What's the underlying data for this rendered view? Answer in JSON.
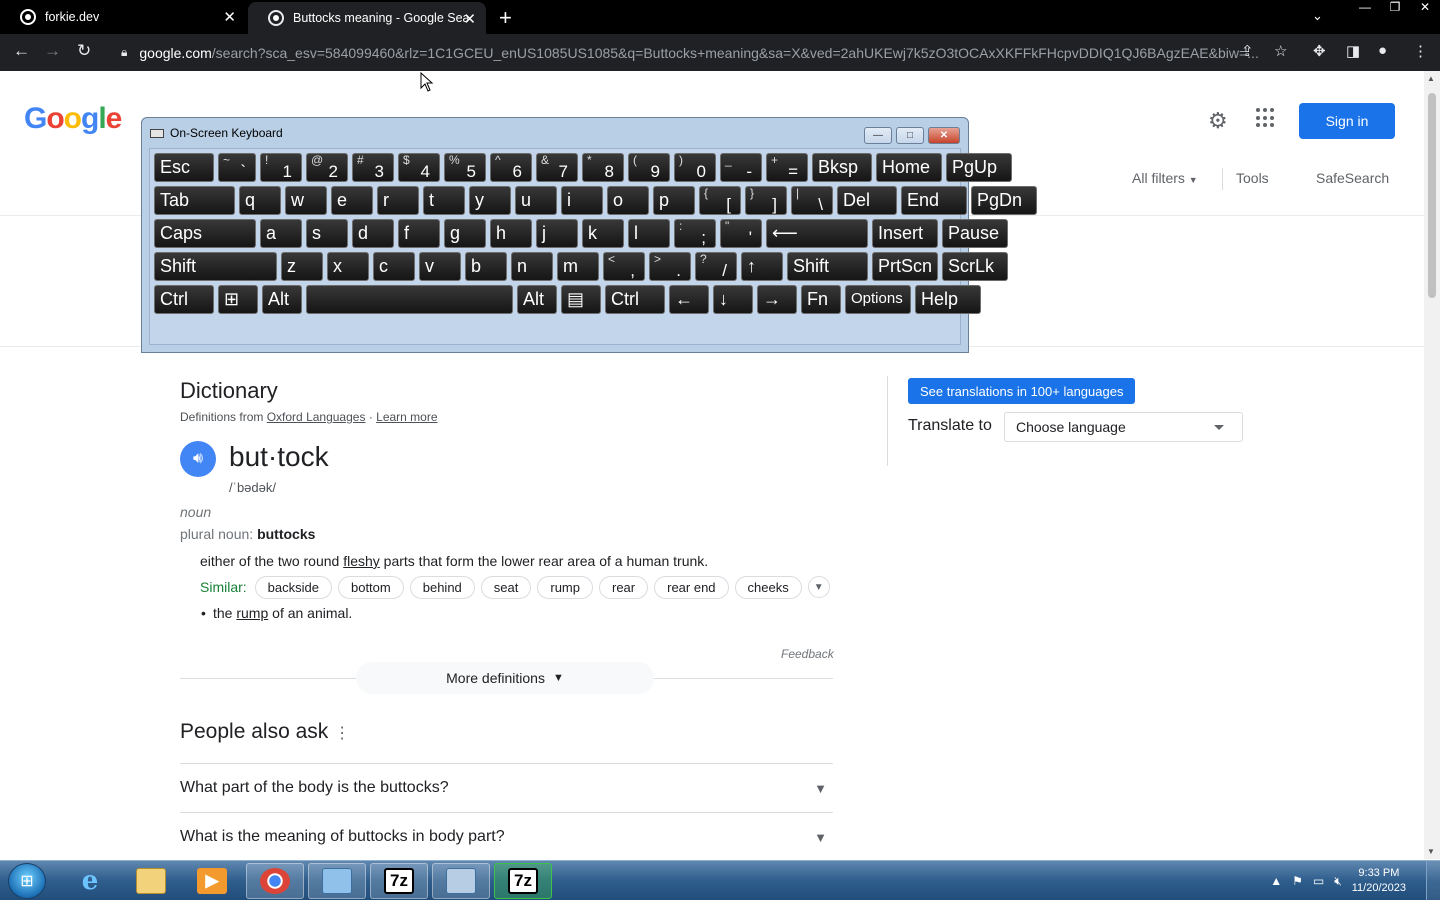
{
  "browser": {
    "tabs": [
      {
        "title": "forkie.dev"
      },
      {
        "title": "Buttocks meaning - Google Search"
      }
    ],
    "url_host": "google.com",
    "url_rest": "/search?sca_esv=584099460&rlz=1C1GCEU_enUS1085US1085&q=Buttocks+meaning&sa=X&ved=2ahUKEwj7k5zO3tOCAxXKFFkFHcpvDDIQ1QJ6BAgzEAE&biw=..."
  },
  "google": {
    "logo": [
      "G",
      "o",
      "o",
      "g",
      "l",
      "e"
    ],
    "sign_in": "Sign in",
    "filters": {
      "all_filters": "All filters",
      "tools": "Tools",
      "safesearch": "SafeSearch"
    }
  },
  "dictionary": {
    "title": "Dictionary",
    "source_prefix": "Definitions from",
    "source_link": "Oxford Languages",
    "separator": "·",
    "learn_more": "Learn more",
    "word": "but·tock",
    "phonetic": "/ˈbədək/",
    "part_of_speech": "noun",
    "plural_label": "plural noun:",
    "plural_value": "buttocks",
    "definition_1_a": "either of the two round",
    "definition_1_link": "fleshy",
    "definition_1_b": "parts that form the lower rear area of a human trunk.",
    "similar_label": "Similar:",
    "similar": [
      "backside",
      "bottom",
      "behind",
      "seat",
      "rump",
      "rear",
      "rear end",
      "cheeks"
    ],
    "definition_2_a": "the",
    "definition_2_link": "rump",
    "definition_2_b": "of an animal.",
    "feedback": "Feedback",
    "more_definitions": "More definitions"
  },
  "translate": {
    "button": "See translations in 100+ languages",
    "label": "Translate to",
    "select": "Choose language"
  },
  "people_also_ask": {
    "title": "People also ask",
    "questions": [
      "What part of the body is the buttocks?",
      "What is the meaning of buttocks in body part?"
    ]
  },
  "osk": {
    "title": "On-Screen Keyboard",
    "rows": [
      [
        {
          "m": "Esc"
        },
        {
          "s": "~",
          "m": "`"
        },
        {
          "s": "!",
          "m": "1"
        },
        {
          "s": "@",
          "m": "2"
        },
        {
          "s": "#",
          "m": "3"
        },
        {
          "s": "$",
          "m": "4"
        },
        {
          "s": "%",
          "m": "5"
        },
        {
          "s": "^",
          "m": "6"
        },
        {
          "s": "&",
          "m": "7"
        },
        {
          "s": "*",
          "m": "8"
        },
        {
          "s": "(",
          "m": "9"
        },
        {
          "s": ")",
          "m": "0"
        },
        {
          "s": "_",
          "m": "-"
        },
        {
          "s": "+",
          "m": "="
        },
        {
          "m": "Bksp"
        },
        {
          "m": "Home"
        },
        {
          "m": "PgUp"
        }
      ],
      [
        {
          "m": "Tab"
        },
        {
          "m": "q"
        },
        {
          "m": "w"
        },
        {
          "m": "e"
        },
        {
          "m": "r"
        },
        {
          "m": "t"
        },
        {
          "m": "y"
        },
        {
          "m": "u"
        },
        {
          "m": "i"
        },
        {
          "m": "o"
        },
        {
          "m": "p"
        },
        {
          "s": "{",
          "m": "["
        },
        {
          "s": "}",
          "m": "]"
        },
        {
          "s": "|",
          "m": "\\"
        },
        {
          "m": "Del"
        },
        {
          "m": "End"
        },
        {
          "m": "PgDn"
        }
      ],
      [
        {
          "m": "Caps"
        },
        {
          "m": "a"
        },
        {
          "m": "s"
        },
        {
          "m": "d"
        },
        {
          "m": "f"
        },
        {
          "m": "g"
        },
        {
          "m": "h"
        },
        {
          "m": "j"
        },
        {
          "m": "k"
        },
        {
          "m": "l"
        },
        {
          "s": ":",
          "m": ";"
        },
        {
          "s": "\"",
          "m": "'"
        },
        {
          "m": "⟵"
        },
        {
          "m": "Insert"
        },
        {
          "m": "Pause"
        }
      ],
      [
        {
          "m": "Shift"
        },
        {
          "m": "z"
        },
        {
          "m": "x"
        },
        {
          "m": "c"
        },
        {
          "m": "v"
        },
        {
          "m": "b"
        },
        {
          "m": "n"
        },
        {
          "m": "m"
        },
        {
          "s": "<",
          "m": ","
        },
        {
          "s": ">",
          "m": "."
        },
        {
          "s": "?",
          "m": "/"
        },
        {
          "m": "↑"
        },
        {
          "m": "Shift"
        },
        {
          "m": "PrtScn"
        },
        {
          "m": "ScrLk"
        }
      ],
      [
        {
          "m": "Ctrl"
        },
        {
          "m": "⊞"
        },
        {
          "m": "Alt"
        },
        {
          "m": ""
        },
        {
          "m": "Alt"
        },
        {
          "m": "▤"
        },
        {
          "m": "Ctrl"
        },
        {
          "m": "←"
        },
        {
          "m": "↓"
        },
        {
          "m": "→"
        },
        {
          "m": "Fn"
        },
        {
          "m": "Options"
        },
        {
          "m": "Help"
        }
      ]
    ]
  },
  "taskbar": {
    "items": [
      "start",
      "internet-explorer",
      "file-explorer",
      "media-player",
      "chrome",
      "control-panel",
      "7zip",
      "network",
      "7zip-active"
    ],
    "labels": {
      "7zip": "7z",
      "7zip-active": "7z"
    },
    "time": "9:33 PM",
    "date": "11/20/2023"
  }
}
